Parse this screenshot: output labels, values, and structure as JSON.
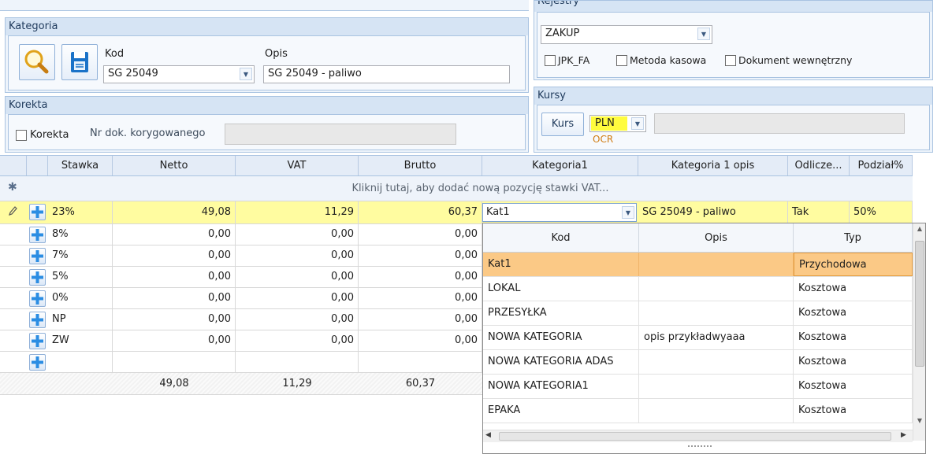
{
  "rejestry": {
    "title": "Rejestry",
    "select_value": "ZAKUP",
    "checkboxes": [
      {
        "label": "JPK_FA",
        "checked": false
      },
      {
        "label": "Metoda kasowa",
        "checked": false
      },
      {
        "label": "Dokument wewnętrzny",
        "checked": false
      }
    ]
  },
  "kategoria": {
    "title": "Kategoria",
    "kod_label": "Kod",
    "opis_label": "Opis",
    "kod_value": "SG 25049",
    "opis_value": "SG 25049 - paliwo"
  },
  "korekta": {
    "title": "Korekta",
    "checkbox_label": "Korekta",
    "nr_label": "Nr dok. korygowanego",
    "nr_value": ""
  },
  "kursy": {
    "title": "Kursy",
    "button_label": "Kurs",
    "currency": "PLN",
    "currency_sub": "OCR",
    "rate_value": ""
  },
  "grid": {
    "columns": [
      "Stawka",
      "Netto",
      "VAT",
      "Brutto",
      "Kategoria1",
      "Kategoria 1 opis",
      "Odlicze...",
      "Podział%"
    ],
    "new_row_text": "Kliknij tutaj, aby dodać nową pozycję stawki VAT...",
    "active_row": {
      "stawka": "23%",
      "netto": "49,08",
      "vat": "11,29",
      "brutto": "60,37",
      "kategoria_editor": "Kat1",
      "kategoria_opis": "SG 25049 - paliwo",
      "odliczenia": "Tak",
      "podzial": "50%"
    },
    "rows": [
      {
        "stawka": "8%",
        "netto": "0,00",
        "vat": "0,00",
        "brutto": "0,00"
      },
      {
        "stawka": "7%",
        "netto": "0,00",
        "vat": "0,00",
        "brutto": "0,00"
      },
      {
        "stawka": "5%",
        "netto": "0,00",
        "vat": "0,00",
        "brutto": "0,00"
      },
      {
        "stawka": "0%",
        "netto": "0,00",
        "vat": "0,00",
        "brutto": "0,00"
      },
      {
        "stawka": "NP",
        "netto": "0,00",
        "vat": "0,00",
        "brutto": "0,00"
      },
      {
        "stawka": "ZW",
        "netto": "0,00",
        "vat": "0,00",
        "brutto": "0,00"
      }
    ],
    "totals": {
      "netto": "49,08",
      "vat": "11,29",
      "brutto": "60,37"
    }
  },
  "dropdown": {
    "columns": [
      "Kod",
      "Opis",
      "Typ"
    ],
    "rows": [
      {
        "kod": "Kat1",
        "opis": "",
        "typ": "Przychodowa"
      },
      {
        "kod": "LOKAL",
        "opis": "",
        "typ": "Kosztowa"
      },
      {
        "kod": "PRZESYŁKA",
        "opis": "",
        "typ": "Kosztowa"
      },
      {
        "kod": "NOWA KATEGORIA",
        "opis": "opis przykładwyaaa",
        "typ": "Kosztowa"
      },
      {
        "kod": "NOWA KATEGORIA ADAS",
        "opis": "",
        "typ": "Kosztowa"
      },
      {
        "kod": "NOWA KATEGORIA1",
        "opis": "",
        "typ": "Kosztowa"
      },
      {
        "kod": "EPAKA",
        "opis": "",
        "typ": "Kosztowa"
      }
    ]
  },
  "colors": {
    "panel_border": "#a9c3e1",
    "active_row": "#fffca0",
    "selected_row": "#fbc986",
    "accent": "#2b73c2"
  }
}
